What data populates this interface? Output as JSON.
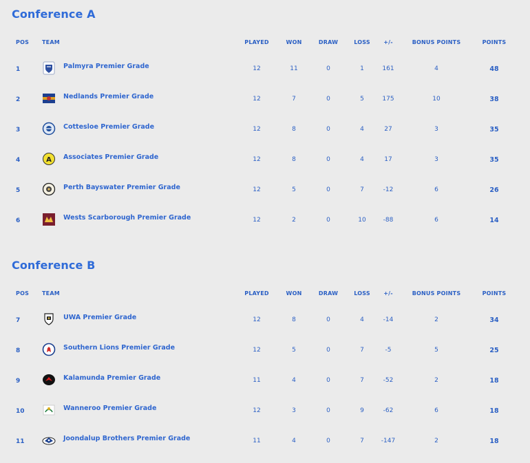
{
  "columns": {
    "pos": "POS",
    "team": "TEAM",
    "played": "PLAYED",
    "won": "WON",
    "draw": "DRAW",
    "loss": "LOSS",
    "diff": "+/-",
    "bonus": "BONUS POINTS",
    "points": "POINTS"
  },
  "conferences": [
    {
      "title": "Conference A",
      "rows": [
        {
          "pos": "1",
          "team": "Palmyra Premier Grade",
          "played": "12",
          "won": "11",
          "draw": "0",
          "loss": "1",
          "diff": "161",
          "bonus": "4",
          "points": "48",
          "logo": "palmyra-logo"
        },
        {
          "pos": "2",
          "team": "Nedlands Premier Grade",
          "played": "12",
          "won": "7",
          "draw": "0",
          "loss": "5",
          "diff": "175",
          "bonus": "10",
          "points": "38",
          "logo": "nedlands-logo"
        },
        {
          "pos": "3",
          "team": "Cottesloe Premier Grade",
          "played": "12",
          "won": "8",
          "draw": "0",
          "loss": "4",
          "diff": "27",
          "bonus": "3",
          "points": "35",
          "logo": "cottesloe-logo"
        },
        {
          "pos": "4",
          "team": "Associates Premier Grade",
          "played": "12",
          "won": "8",
          "draw": "0",
          "loss": "4",
          "diff": "17",
          "bonus": "3",
          "points": "35",
          "logo": "associates-logo"
        },
        {
          "pos": "5",
          "team": "Perth Bayswater Premier Grade",
          "played": "12",
          "won": "5",
          "draw": "0",
          "loss": "7",
          "diff": "-12",
          "bonus": "6",
          "points": "26",
          "logo": "perth-bayswater-logo"
        },
        {
          "pos": "6",
          "team": "Wests Scarborough Premier Grade",
          "played": "12",
          "won": "2",
          "draw": "0",
          "loss": "10",
          "diff": "-88",
          "bonus": "6",
          "points": "14",
          "logo": "wests-scarborough-logo"
        }
      ]
    },
    {
      "title": "Conference B",
      "rows": [
        {
          "pos": "7",
          "team": "UWA Premier Grade",
          "played": "12",
          "won": "8",
          "draw": "0",
          "loss": "4",
          "diff": "-14",
          "bonus": "2",
          "points": "34",
          "logo": "uwa-logo"
        },
        {
          "pos": "8",
          "team": "Southern Lions Premier Grade",
          "played": "12",
          "won": "5",
          "draw": "0",
          "loss": "7",
          "diff": "-5",
          "bonus": "5",
          "points": "25",
          "logo": "southern-lions-logo"
        },
        {
          "pos": "9",
          "team": "Kalamunda Premier Grade",
          "played": "11",
          "won": "4",
          "draw": "0",
          "loss": "7",
          "diff": "-52",
          "bonus": "2",
          "points": "18",
          "logo": "kalamunda-logo"
        },
        {
          "pos": "10",
          "team": "Wanneroo Premier Grade",
          "played": "12",
          "won": "3",
          "draw": "0",
          "loss": "9",
          "diff": "-62",
          "bonus": "6",
          "points": "18",
          "logo": "wanneroo-logo"
        },
        {
          "pos": "11",
          "team": "Joondalup Brothers Premier Grade",
          "played": "11",
          "won": "4",
          "draw": "0",
          "loss": "7",
          "diff": "-147",
          "bonus": "2",
          "points": "18",
          "logo": "joondalup-logo"
        }
      ]
    }
  ],
  "colors": {
    "background": "#ebebeb",
    "accent": "#2f6bd8",
    "text": "#2a5fc4"
  }
}
